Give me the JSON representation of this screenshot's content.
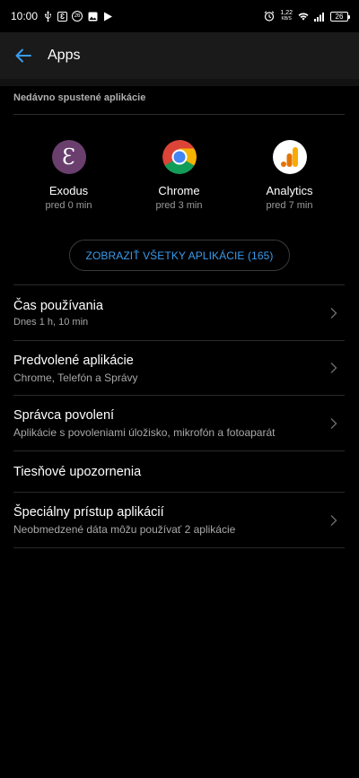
{
  "status_bar": {
    "time": "10:00",
    "network_speed_top": "1,22",
    "network_speed_bottom": "KB/S",
    "notif_badge": "26",
    "battery": "26"
  },
  "app_bar": {
    "title": "Apps"
  },
  "recent": {
    "header": "Nedávno spustené aplikácie",
    "apps": [
      {
        "name": "Exodus",
        "time": "pred 0 min",
        "icon": "exodus-icon",
        "color": "#6a3f6e",
        "glyph": "Ɛ"
      },
      {
        "name": "Chrome",
        "time": "pred 3 min",
        "icon": "chrome-icon"
      },
      {
        "name": "Analytics",
        "time": "pred 7 min",
        "icon": "analytics-icon"
      }
    ],
    "show_all": "ZOBRAZIŤ VŠETKY APLIKÁCIE (165)"
  },
  "list": [
    {
      "title": "Čas používania",
      "subtitle": "Dnes 1 h, 10 min",
      "chevron": true
    },
    {
      "title": "Predvolené aplikácie",
      "subtitle": "Chrome, Telefón a Správy",
      "chevron": true
    },
    {
      "title": "Správca povolení",
      "subtitle": "Aplikácie s povoleniami úložisko, mikrofón a fotoaparát",
      "chevron": true
    },
    {
      "title": "Tiesňové upozornenia",
      "subtitle": "",
      "chevron": false
    },
    {
      "title": "Špeciálny prístup aplikácií",
      "subtitle": "Neobmedzené dáta môžu používať 2 aplikácie",
      "chevron": true
    }
  ],
  "colors": {
    "accent": "#3a9bea",
    "background": "#000000",
    "app_bar": "#1a1a1a"
  }
}
